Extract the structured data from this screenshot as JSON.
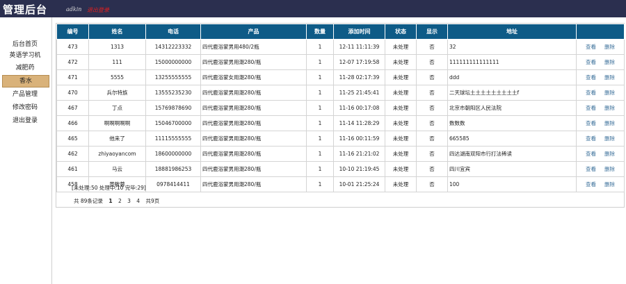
{
  "header": {
    "title": "管理后台",
    "user": "adkin",
    "logout": "退出登录"
  },
  "sidebar": {
    "items": [
      {
        "label": "后台首页"
      },
      {
        "label": "英语学习机"
      },
      {
        "label": "减肥药"
      },
      {
        "label": "香水"
      },
      {
        "label": "产品管理"
      },
      {
        "label": "修改密码"
      },
      {
        "label": "退出登录"
      }
    ]
  },
  "table": {
    "columns": [
      "编号",
      "姓名",
      "电话",
      "产品",
      "数量",
      "添加时间",
      "状态",
      "显示",
      "地址",
      ""
    ],
    "rows": [
      [
        "473",
        "1313",
        "14312223332",
        "四代鹿浴蒙男用480/2瓶",
        "1",
        "12-11 11:11:39",
        "未处理",
        "否",
        "32"
      ],
      [
        "472",
        "111",
        "15000000000",
        "四代鹿浴蒙男用潮280/瓶",
        "1",
        "12-07 17:19:58",
        "未处理",
        "否",
        "111111111111111"
      ],
      [
        "471",
        "5555",
        "13255555555",
        "四代鹿浴蒙女用潮280/瓶",
        "1",
        "11-28 02:17:39",
        "未处理",
        "否",
        "ddd"
      ],
      [
        "470",
        "兵尔特族",
        "13555235230",
        "四代鹿浴蒙男用潮280/瓶",
        "1",
        "11-25 21:45:41",
        "未处理",
        "否",
        "二天球坛土土土土土土土土土f"
      ],
      [
        "467",
        "丁点",
        "15769878690",
        "四代鹿浴蒙男用潮280/瓶",
        "1",
        "11-16 00:17:08",
        "未处理",
        "否",
        "北京市朝阳区人民法院"
      ],
      [
        "466",
        "啊啊啊啊啊",
        "15046700000",
        "四代鹿浴蒙男用潮280/瓶",
        "1",
        "11-14 11:28:29",
        "未处理",
        "否",
        "数数数"
      ],
      [
        "465",
        "他来了",
        "11115555555",
        "四代鹿浴蒙男用潮280/瓶",
        "1",
        "11-16 00:11:59",
        "未处理",
        "否",
        "665585"
      ],
      [
        "462",
        "zhiyaoyancom",
        "18600000000",
        "四代鹿浴蒙男用潮280/瓶",
        "1",
        "11-16 21:21:02",
        "未处理",
        "否",
        "四达湖南双阳市行打法稀读"
      ],
      [
        "461",
        "马云",
        "18881986253",
        "四代鹿浴蒙男用潮280/瓶",
        "1",
        "10-10 21:19:45",
        "未处理",
        "否",
        "四川宜宾"
      ],
      [
        "458",
        "黄敏蓉",
        "0978414411",
        "四代鹿浴蒙男用潮280/瓶",
        "1",
        "10-01 21:25:24",
        "未处理",
        "否",
        "100"
      ]
    ],
    "action_view": "查看",
    "action_delete": "删除"
  },
  "stats": "[未处理:50  处理中:10  完毕:29]",
  "pager": {
    "summary": "共 89条记录",
    "pages": [
      "1",
      "2",
      "3",
      "4"
    ],
    "current": "1",
    "total": "共9页"
  }
}
